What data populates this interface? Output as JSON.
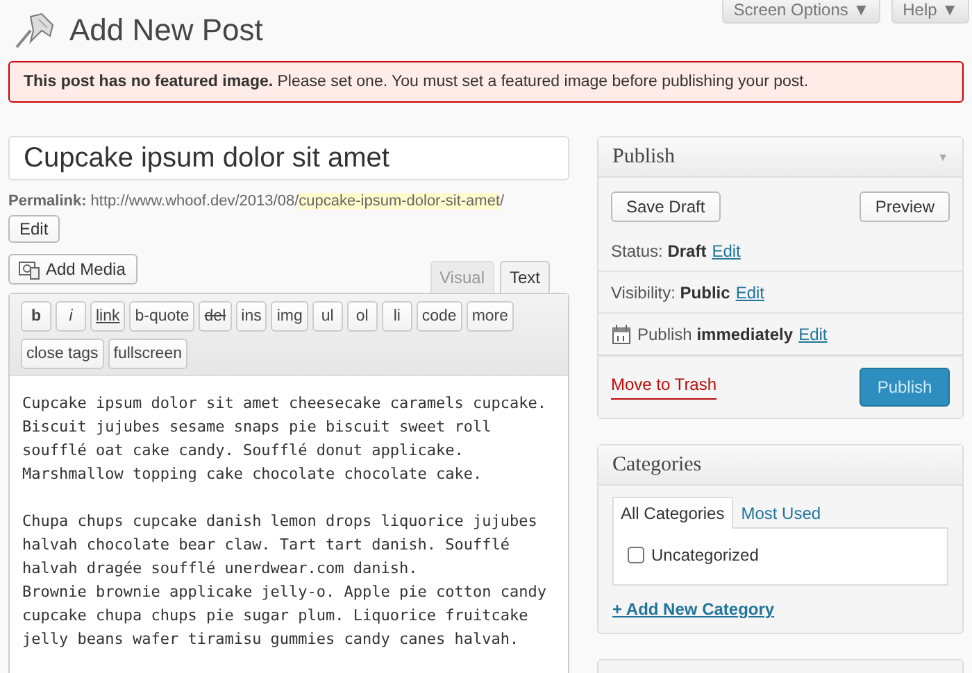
{
  "header": {
    "title": "Add New Post",
    "screen_options": "Screen Options ▼",
    "help": "Help ▼"
  },
  "notice": {
    "text": "**This post has no featured image.** Please set one. You must set a featured image before publishing your post."
  },
  "post_title": {
    "value": "Cupcake ipsum dolor sit amet"
  },
  "permalink": {
    "label": "Permalink:",
    "base": "http://www.whoof.dev/2013/08/",
    "slug": "cupcake-ipsum-dolor-sit-amet",
    "trailing": "/",
    "edit_button": "Edit"
  },
  "add_media": "Add Media",
  "editor_tabs": [
    {
      "label": "Visual",
      "selected": false
    },
    {
      "label": "Text",
      "selected": true
    }
  ],
  "toolbar": [
    {
      "label": "b",
      "kind": "bold"
    },
    {
      "label": "i",
      "kind": "italic"
    },
    {
      "label": "link",
      "kind": "link"
    },
    {
      "label": "b-quote",
      "kind": "plain"
    },
    {
      "label": "del",
      "kind": "strike"
    },
    {
      "label": "ins",
      "kind": "plain"
    },
    {
      "label": "img",
      "kind": "plain"
    },
    {
      "label": "ul",
      "kind": "plain"
    },
    {
      "label": "ol",
      "kind": "plain"
    },
    {
      "label": "li",
      "kind": "plain"
    },
    {
      "label": "code",
      "kind": "plain"
    },
    {
      "label": "more",
      "kind": "plain"
    },
    {
      "label": "close tags",
      "kind": "plain"
    },
    {
      "label": "fullscreen",
      "kind": "plain"
    }
  ],
  "content": "Cupcake ipsum dolor sit amet cheesecake caramels cupcake.\nBiscuit jujubes sesame snaps pie biscuit sweet roll\nsoufflé oat cake candy. Soufflé donut applicake.\nMarshmallow topping cake chocolate chocolate cake.\n\nChupa chups cupcake danish lemon drops liquorice jujubes\nhalvah chocolate bear claw. Tart tart danish. Soufflé\nhalvah dragée soufflé unerdwear.com danish.\nBrownie brownie applicake jelly-o. Apple pie cotton candy\ncupcake chupa chups pie sugar plum. Liquorice fruitcake\njelly beans wafer tiramisu gummies candy canes halvah.",
  "publish": {
    "title": "Publish",
    "toggle": "▼",
    "save_draft": "Save Draft",
    "preview": "Preview",
    "rows": [
      {
        "kind": "plain",
        "label": "Status:",
        "value": "Draft",
        "link": "Edit"
      },
      {
        "kind": "plain",
        "label": "Visibility:",
        "value": "Public",
        "link": "Edit"
      },
      {
        "kind": "calendar",
        "label": "Publish",
        "value": "immediately",
        "link": "Edit"
      }
    ],
    "move_to_trash": "Move to Trash",
    "publish_button": "Publish"
  },
  "categories": {
    "title": "Categories",
    "tabs": [
      {
        "label": "All Categories",
        "selected": true
      },
      {
        "label": "Most Used",
        "selected": false
      }
    ],
    "items": [
      {
        "label": "Uncategorized",
        "checked": false
      }
    ],
    "add_new": "+ Add New Category"
  }
}
